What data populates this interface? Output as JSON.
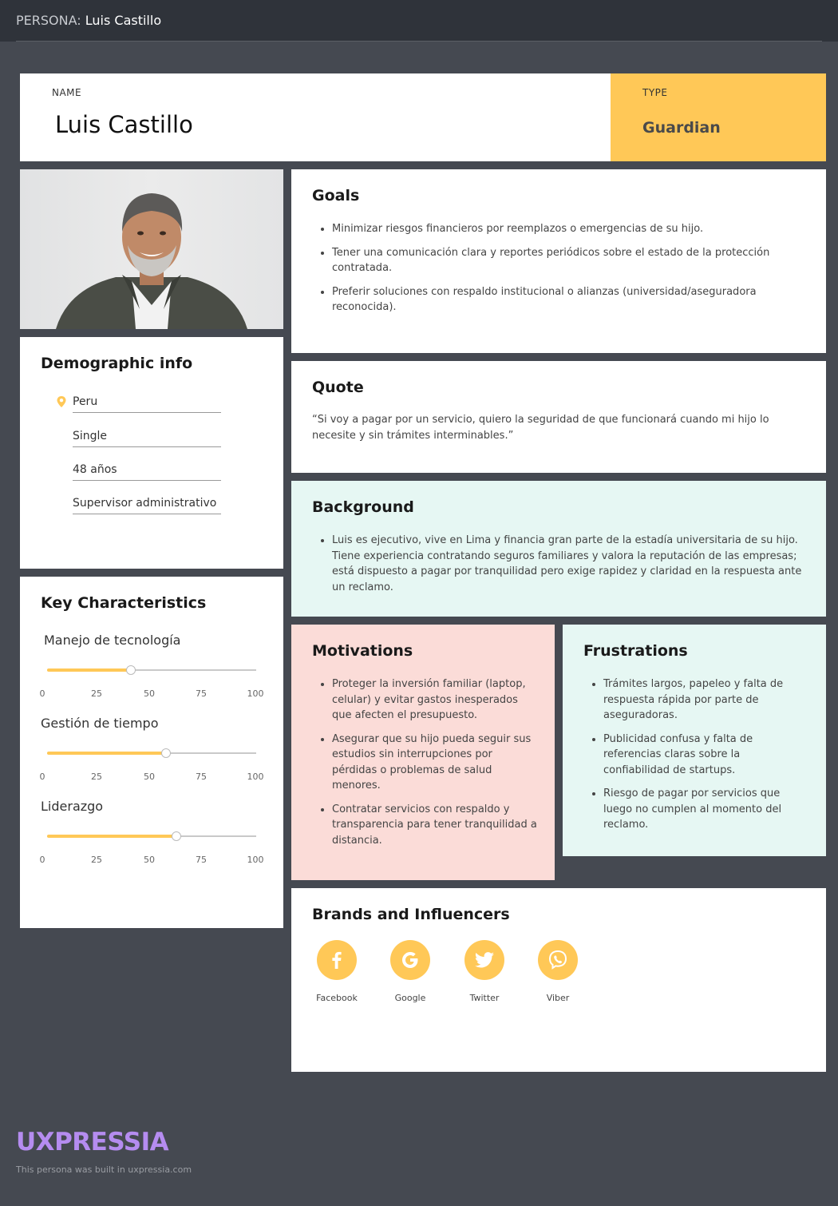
{
  "topbar": {
    "prefix": "PERSONA:",
    "name": "Luis Castillo"
  },
  "header": {
    "name_label": "NAME",
    "name": "Luis Castillo",
    "type_label": "TYPE",
    "type": "Guardian"
  },
  "demographic": {
    "title": "Demographic info",
    "location": "Peru",
    "status": "Single",
    "age": "48 años",
    "occupation": "Supervisor administrativo"
  },
  "key_characteristics": {
    "title": "Key Characteristics",
    "ticks": [
      "0",
      "25",
      "50",
      "75",
      "100"
    ],
    "sliders": [
      {
        "label": "Manejo de tecnología",
        "value": 40
      },
      {
        "label": "Gestión de tiempo",
        "value": 57
      },
      {
        "label": "Liderazgo",
        "value": 62
      }
    ]
  },
  "goals": {
    "title": "Goals",
    "items": [
      "Minimizar riesgos financieros por reemplazos o emergencias de su hijo.",
      "Tener una comunicación clara y reportes periódicos sobre el estado de la protección contratada.",
      "Preferir soluciones con respaldo institucional o alianzas (universidad/aseguradora reconocida)."
    ]
  },
  "quote": {
    "title": "Quote",
    "text": "“Si voy a pagar por un servicio, quiero la seguridad de que funcionará cuando mi hijo lo necesite y sin trámites interminables.”"
  },
  "background": {
    "title": "Background",
    "items": [
      "Luis es ejecutivo, vive en Lima y financia gran parte de la estadía universitaria de su hijo. Tiene experiencia contratando seguros familiares y valora la reputación de las empresas; está dispuesto a pagar por tranquilidad pero exige rapidez y claridad en la respuesta ante un reclamo."
    ]
  },
  "motivations": {
    "title": "Motivations",
    "items": [
      "Proteger la inversión familiar (laptop, celular) y evitar gastos inesperados que afecten el presupuesto.",
      "Asegurar que su hijo pueda seguir sus estudios sin interrupciones por pérdidas o problemas de salud menores.",
      "Contratar servicios con respaldo y transparencia para tener tranquilidad a distancia."
    ]
  },
  "frustrations": {
    "title": "Frustrations",
    "items": [
      "Trámites largos, papeleo y falta de respuesta rápida por parte de aseguradoras.",
      "Publicidad confusa y falta de referencias claras sobre la confiabilidad de startups.",
      "Riesgo de pagar por servicios que luego no cumplen al momento del reclamo."
    ]
  },
  "brands": {
    "title": "Brands and Influencers",
    "items": [
      {
        "name": "Facebook",
        "icon": "facebook-icon"
      },
      {
        "name": "Google",
        "icon": "google-icon"
      },
      {
        "name": "Twitter",
        "icon": "twitter-icon"
      },
      {
        "name": "Viber",
        "icon": "viber-icon"
      }
    ]
  },
  "footer": {
    "logo": "UXPRESSIA",
    "note": "This persona was built in uxpressia.com"
  },
  "colors": {
    "accent": "#ffc857",
    "mint": "#e6f7f3",
    "pink": "#fbdcd8",
    "background": "#454951",
    "logo": "#b58cf0"
  }
}
